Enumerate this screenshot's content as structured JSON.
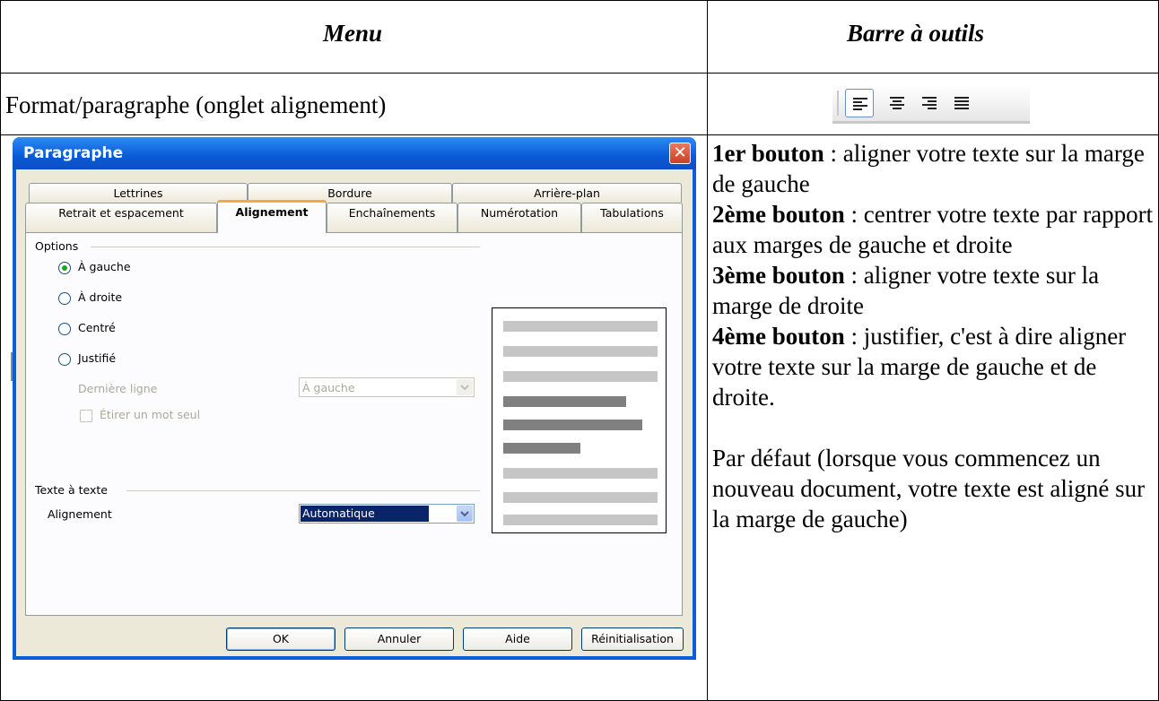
{
  "table": {
    "header_menu": "Menu",
    "header_toolbar": "Barre à outils",
    "row1_menu": "Format/paragraphe (onglet alignement)"
  },
  "toolbar_icons": [
    "align-left-icon",
    "align-center-icon",
    "align-right-icon",
    "align-justify-icon"
  ],
  "description": {
    "b1_label": "1er bouton",
    "b1_text": " : aligner votre texte sur la marge de gauche",
    "b2_label": "2ème bouton",
    "b2_text": " : centrer votre texte par rapport aux marges de gauche et droite",
    "b3_label": "3ème bouton",
    "b3_text": " : aligner votre texte sur la marge de droite",
    "b4_label": "4ème bouton",
    "b4_text": " : justifier, c'est à dire aligner votre texte sur la marge de gauche et de droite.",
    "default_text": "Par défaut (lorsque vous commencez un nouveau document, votre texte est aligné sur la marge de gauche)"
  },
  "dialog": {
    "title": "Paragraphe",
    "close_symbol": "✕",
    "tabs_row1": [
      "Lettrines",
      "Bordure",
      "Arrière-plan"
    ],
    "tabs_row2": [
      "Retrait et espacement",
      "Alignement",
      "Enchaînements",
      "Numérotation",
      "Tabulations"
    ],
    "selected_tab": "Alignement",
    "options_label": "Options",
    "options": [
      "À gauche",
      "À droite",
      "Centré",
      "Justifié"
    ],
    "selected_option": "À gauche",
    "last_line_label": "Dernière ligne",
    "last_line_value": "À gauche",
    "stretch_label": "Étirer un mot seul",
    "text_to_text_label": "Texte à texte",
    "alignment_label": "Alignement",
    "alignment_value": "Automatique",
    "buttons": [
      "OK",
      "Annuler",
      "Aide",
      "Réinitialisation"
    ]
  },
  "colors": {
    "titlebar": "#0a5fd8",
    "dialog_bg": "#ece9d8",
    "tab_highlight": "#f7a83e",
    "selection": "#0a246a"
  }
}
